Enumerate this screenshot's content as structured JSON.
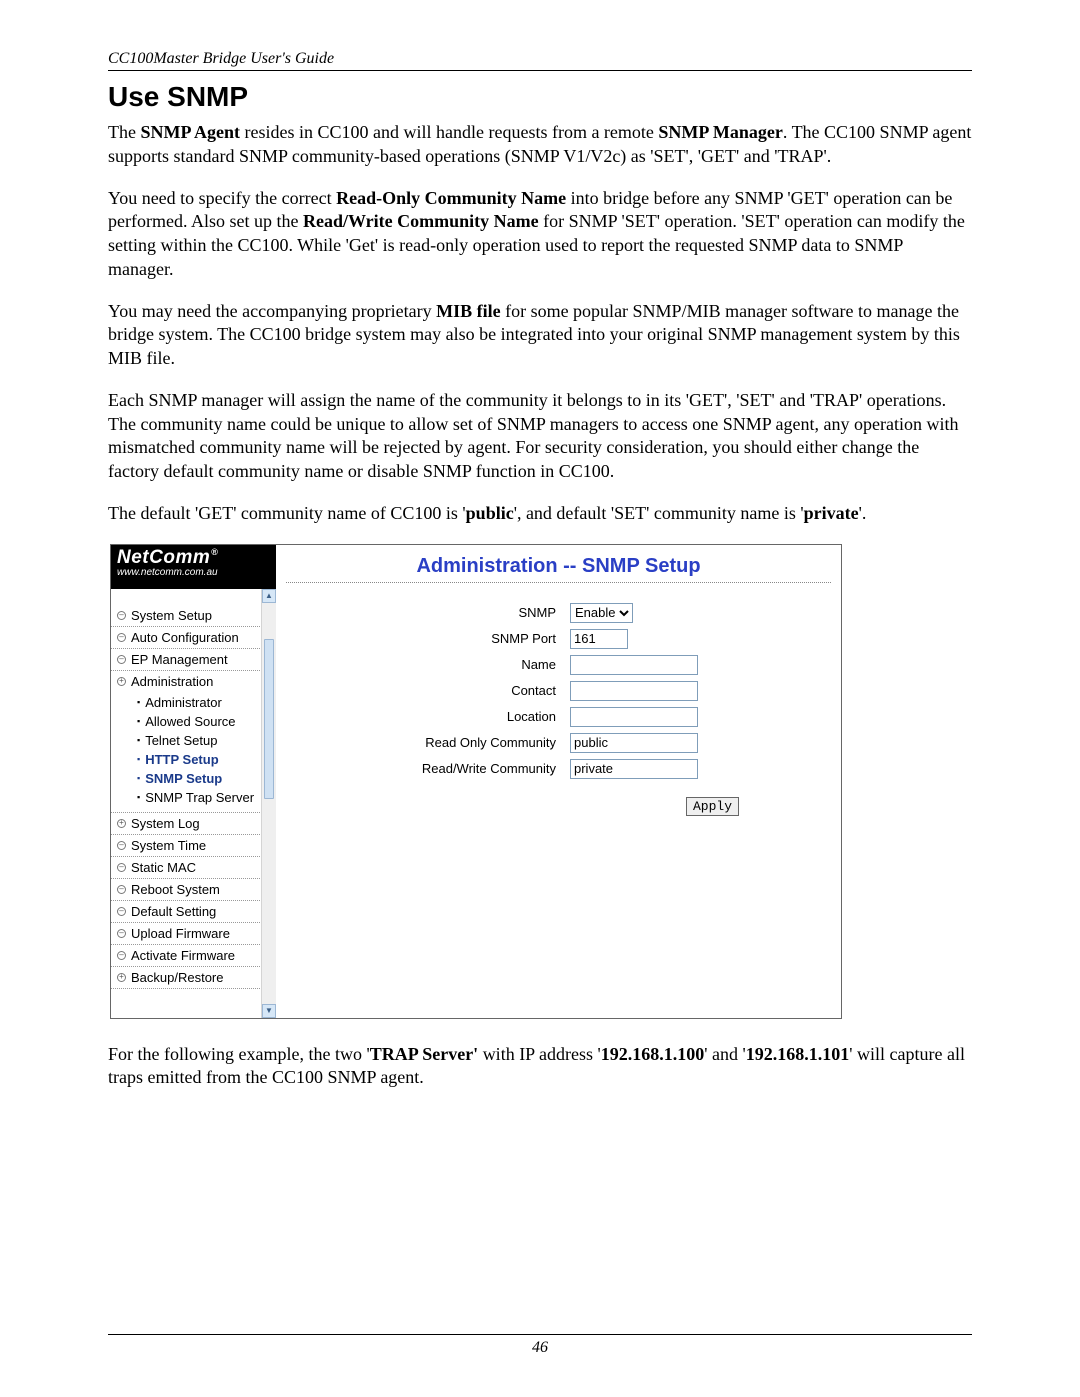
{
  "doc": {
    "running_header": "CC100Master Bridge User's Guide",
    "section_title": "Use SNMP",
    "page_number": "46",
    "p1_parts": [
      {
        "t": "The "
      },
      {
        "t": "SNMP Agent",
        "b": true
      },
      {
        "t": " resides in CC100 and will handle requests from a remote "
      },
      {
        "t": "SNMP Manager",
        "b": true
      },
      {
        "t": ". The CC100 SNMP agent supports standard SNMP community-based operations (SNMP V1/V2c) as 'SET', 'GET' and 'TRAP'."
      }
    ],
    "p2_parts": [
      {
        "t": "You need to specify the correct "
      },
      {
        "t": "Read-Only Community Name",
        "b": true
      },
      {
        "t": " into bridge before any SNMP 'GET' operation can be performed. Also set up the "
      },
      {
        "t": "Read/Write Community Name",
        "b": true
      },
      {
        "t": " for SNMP 'SET' operation. 'SET' operation can modify the setting within the CC100. While 'Get' is read-only operation used to report the requested SNMP data to SNMP manager."
      }
    ],
    "p3_parts": [
      {
        "t": "You may need the accompanying proprietary "
      },
      {
        "t": "MIB file",
        "b": true
      },
      {
        "t": " for some popular SNMP/MIB manager software to manage the bridge system. The CC100 bridge system may also be integrated into your original SNMP management system by this MIB file."
      }
    ],
    "p4_parts": [
      {
        "t": "Each SNMP manager will assign the name of the community it belongs to in its 'GET', 'SET' and 'TRAP' operations. The community name could be unique to allow set of SNMP managers to access one SNMP agent, any operation with mismatched community name will be rejected by agent. For security consideration, you should either change the factory default community name or disable SNMP function in CC100."
      }
    ],
    "p5_parts": [
      {
        "t": "The default 'GET' community name of CC100 is '"
      },
      {
        "t": "public",
        "b": true
      },
      {
        "t": "', and default 'SET' community name is '"
      },
      {
        "t": "private",
        "b": true
      },
      {
        "t": "'."
      }
    ],
    "p6_parts": [
      {
        "t": "For the following example, the two '"
      },
      {
        "t": "TRAP Server'",
        "b": true
      },
      {
        "t": " with IP address '"
      },
      {
        "t": "192.168.1.100",
        "b": true
      },
      {
        "t": "' and '"
      },
      {
        "t": "192.168.1.101",
        "b": true
      },
      {
        "t": "' will capture all traps emitted from the CC100 SNMP agent."
      }
    ]
  },
  "ui": {
    "logo_brand": "NetComm",
    "logo_url": "www.netcomm.com.au",
    "panel_title": "Administration -- SNMP Setup",
    "nav": [
      {
        "label": "System Setup",
        "mark": "–"
      },
      {
        "label": "Auto Configuration",
        "mark": "–"
      },
      {
        "label": "EP Management",
        "mark": "–"
      },
      {
        "label": "Administration",
        "mark": "+",
        "children": [
          {
            "label": "Administrator"
          },
          {
            "label": "Allowed Source"
          },
          {
            "label": "Telnet Setup"
          },
          {
            "label": "HTTP Setup",
            "active": true
          },
          {
            "label": "SNMP Setup",
            "active": true
          },
          {
            "label": "SNMP Trap Server"
          }
        ]
      },
      {
        "label": "System Log",
        "mark": "+"
      },
      {
        "label": "System Time",
        "mark": "–"
      },
      {
        "label": "Static MAC",
        "mark": "–"
      },
      {
        "label": "Reboot System",
        "mark": "–"
      },
      {
        "label": "Default Setting",
        "mark": "–"
      },
      {
        "label": "Upload Firmware",
        "mark": "–"
      },
      {
        "label": "Activate Firmware",
        "mark": "–"
      },
      {
        "label": "Backup/Restore",
        "mark": "+"
      }
    ],
    "form": {
      "snmp_label": "SNMP",
      "snmp_value": "Enable",
      "port_label": "SNMP Port",
      "port_value": "161",
      "name_label": "Name",
      "name_value": "",
      "contact_label": "Contact",
      "contact_value": "",
      "location_label": "Location",
      "location_value": "",
      "ro_label": "Read Only Community",
      "ro_value": "public",
      "rw_label": "Read/Write Community",
      "rw_value": "private",
      "apply_label": "Apply"
    }
  }
}
